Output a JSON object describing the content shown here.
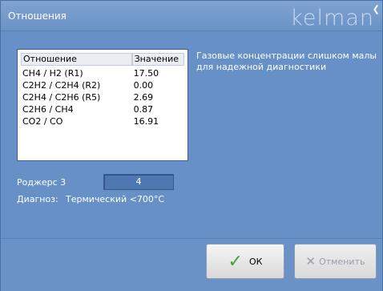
{
  "window": {
    "title": "Отношения",
    "logo_text": "kelman"
  },
  "ratios": {
    "columns": [
      "Отношение",
      "Значение"
    ],
    "rows": [
      [
        "CH4 / H2 (R1)",
        "17.50"
      ],
      [
        "C2H2 / C2H4 (R2)",
        "0.00"
      ],
      [
        "C2H4 / C2H6 (R5)",
        "2.69"
      ],
      [
        "C2H6 / CH4",
        "0.87"
      ],
      [
        "CO2 / CO",
        "16.91"
      ]
    ]
  },
  "message": "Газовые концентрации слишком малы для надежной диагностики",
  "rogers": {
    "label": "Роджерс 3",
    "value": "4"
  },
  "diagnosis": {
    "label": "Диагноз:",
    "value": "Термический <700°C"
  },
  "buttons": {
    "ok_label": "ОК",
    "cancel_label": "Отменить"
  }
}
